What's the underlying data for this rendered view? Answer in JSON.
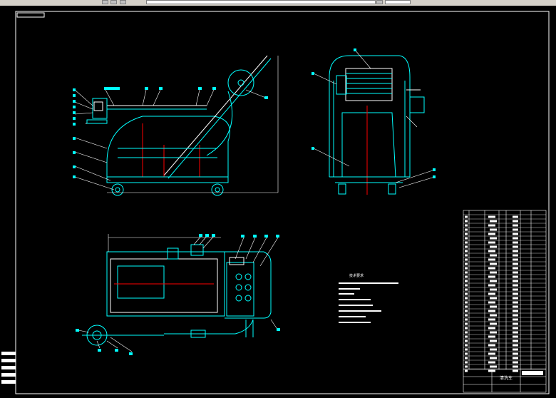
{
  "app": {
    "toolbar_buttons": [
      "layers-icon",
      "properties-icon",
      "undo-icon",
      "redo-icon",
      "zoom-icon"
    ]
  },
  "drawing": {
    "line_color": "#00ffff",
    "red_line_color": "#ff0000",
    "frame_color": "#ffffff",
    "notes_title": "技术要求",
    "title_block": {
      "drawing_name": "清洗车",
      "sheet_label": ""
    }
  }
}
